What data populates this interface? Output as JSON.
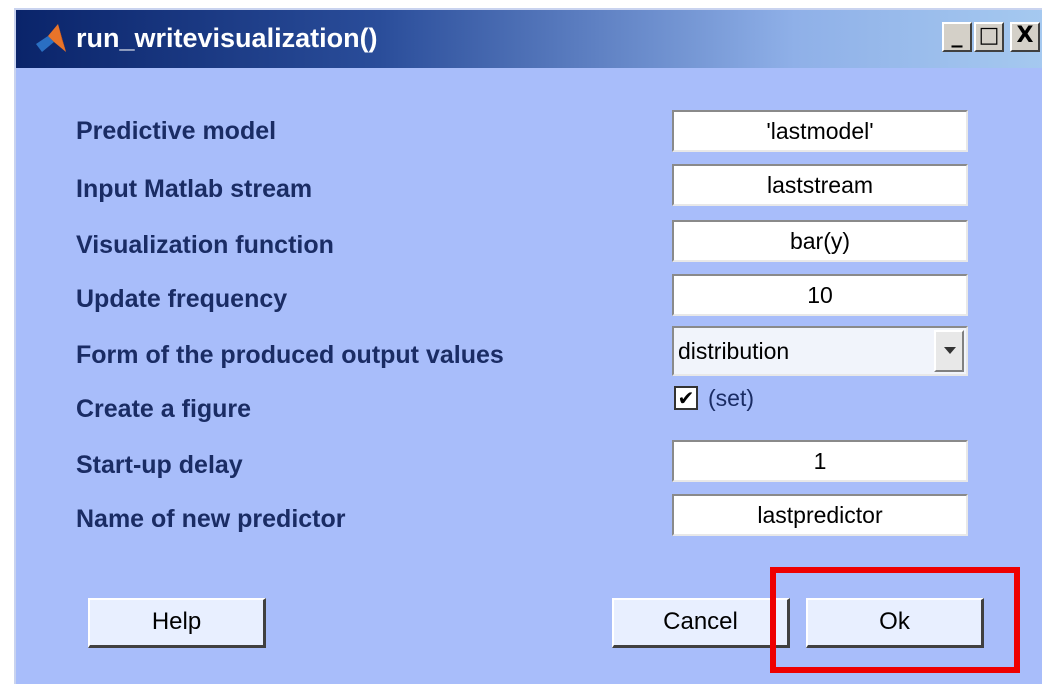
{
  "window": {
    "title": "run_writevisualization()",
    "icon": "matlab-icon",
    "controls": {
      "minimize": "_",
      "maximize": "□",
      "close": "X"
    }
  },
  "form": {
    "fields": [
      {
        "label": "Predictive model",
        "value": "'lastmodel'"
      },
      {
        "label": "Input Matlab stream",
        "value": "laststream"
      },
      {
        "label": "Visualization function",
        "value": "bar(y)"
      },
      {
        "label": "Update frequency",
        "value": "10"
      },
      {
        "label": "Form of the produced output values",
        "value": "distribution"
      },
      {
        "label": "Create a figure",
        "value": "(set)"
      },
      {
        "label": "Start-up delay",
        "value": "1"
      },
      {
        "label": "Name of new predictor",
        "value": "lastpredictor"
      }
    ],
    "checkbox_mark": "✔"
  },
  "buttons": {
    "help": "Help",
    "cancel": "Cancel",
    "ok": "Ok"
  },
  "colors": {
    "background": "#a8bdfa",
    "highlight": "#ee0000",
    "label": "#1a2c64"
  }
}
